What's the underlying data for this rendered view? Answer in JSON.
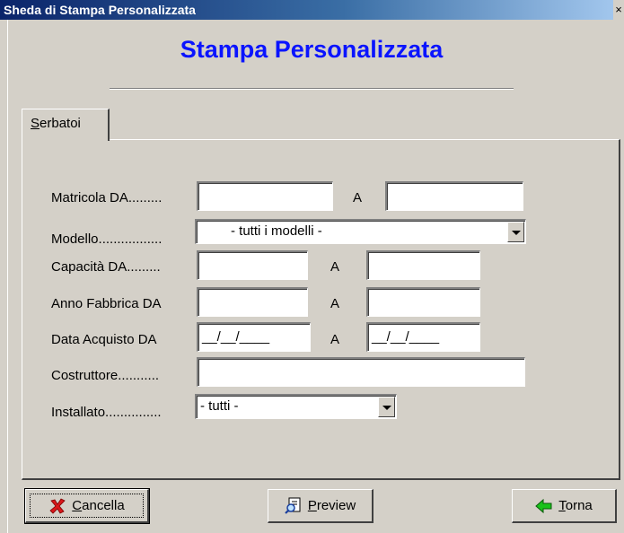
{
  "window": {
    "title": "Sheda di Stampa Personalizzata",
    "close_glyph": "×"
  },
  "heading": "Stampa Personalizzata",
  "tabs": [
    {
      "label": "Serbatoi",
      "active": true
    }
  ],
  "form": {
    "matricola": {
      "label": "Matricola DA.........",
      "from_value": "",
      "to_label": "A",
      "to_value": ""
    },
    "modello": {
      "label": "Modello.................",
      "value": "- tutti i modelli -"
    },
    "capacita": {
      "label": "Capacità DA.........",
      "from_value": "",
      "to_label": "A",
      "to_value": ""
    },
    "anno_fabbrica": {
      "label": "Anno Fabbrica DA",
      "from_value": "",
      "to_label": "A",
      "to_value": ""
    },
    "data_acquisto": {
      "label": "Data Acquisto DA",
      "from_value": "__/__/____",
      "to_label": "A",
      "to_value": "__/__/____"
    },
    "costruttore": {
      "label": "Costruttore...........",
      "value": ""
    },
    "installato": {
      "label": "Installato...............",
      "value": "- tutti -"
    }
  },
  "buttons": {
    "cancella": {
      "label": "Cancella",
      "icon": "red-x-icon"
    },
    "preview": {
      "label": "Preview",
      "icon": "preview-icon"
    },
    "torna": {
      "label": "Torna",
      "icon": "green-arrow-left-icon"
    }
  },
  "colors": {
    "heading": "#0a14ff",
    "titlebar_start": "#0a246a",
    "face": "#d4d0c8"
  }
}
